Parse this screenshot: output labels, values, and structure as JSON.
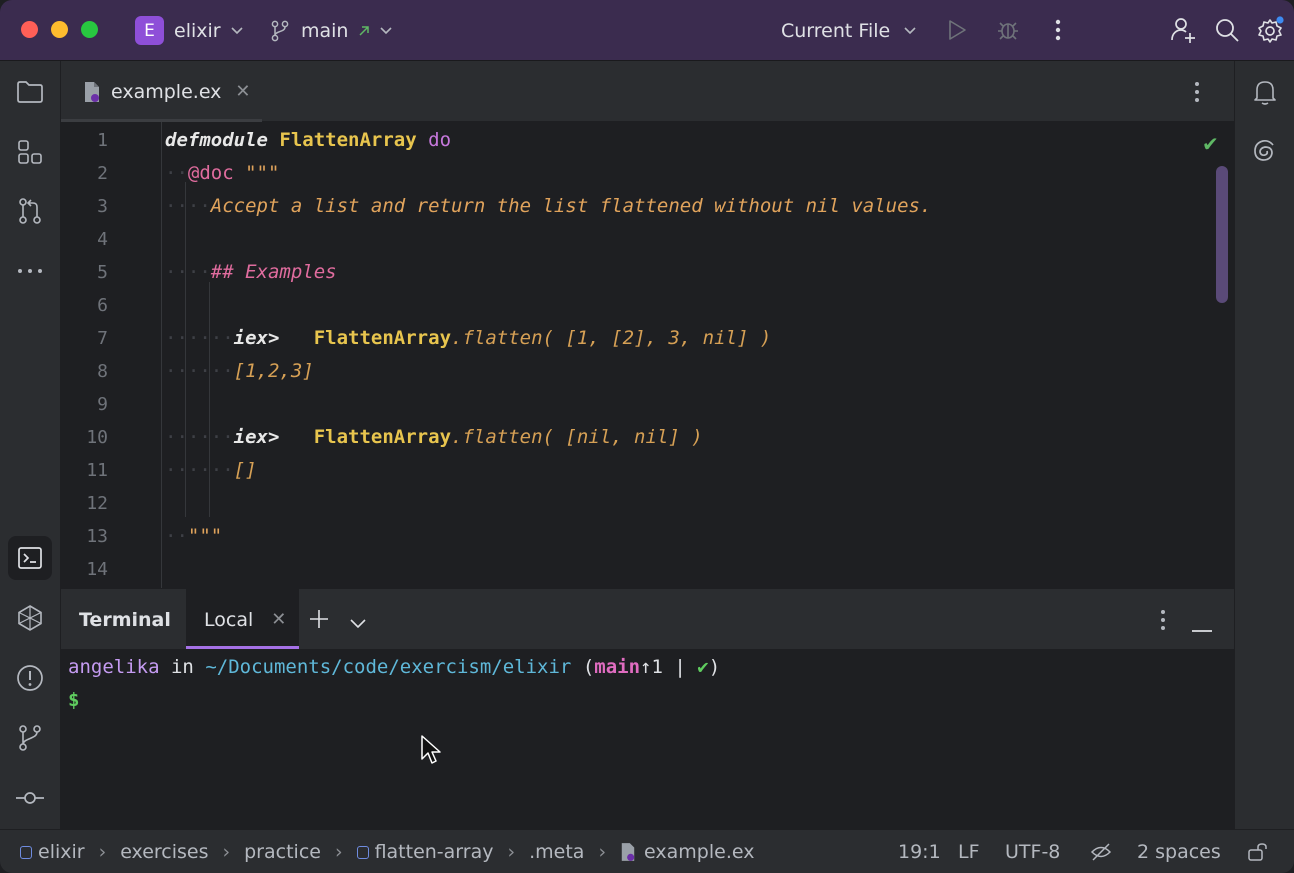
{
  "titlebar": {
    "project_badge": "E",
    "project_name": "elixir",
    "branch": "main",
    "run_config": "Current File"
  },
  "editor": {
    "tab_label": "example.ex",
    "lines": [
      {
        "n": "1"
      },
      {
        "n": "2"
      },
      {
        "n": "3"
      },
      {
        "n": "4"
      },
      {
        "n": "5"
      },
      {
        "n": "6"
      },
      {
        "n": "7"
      },
      {
        "n": "8"
      },
      {
        "n": "9"
      },
      {
        "n": "10"
      },
      {
        "n": "11"
      },
      {
        "n": "12"
      },
      {
        "n": "13"
      },
      {
        "n": "14"
      }
    ],
    "code": {
      "l1_kw": "defmodule",
      "l1_mod": "FlattenArray",
      "l1_do": "do",
      "l2_attr": "@doc",
      "l2_str": "\"\"\"",
      "l3_doc": "Accept a list and return the list flattened without nil values.",
      "l5_hdr": "## Examples",
      "l7_iex": "iex>",
      "l7_mod": "FlattenArray",
      "l7_call": ".flatten( [1, [2], 3, nil] )",
      "l8_out": "[1,2,3]",
      "l10_iex": "iex>",
      "l10_mod": "FlattenArray",
      "l10_call": ".flatten( [nil, nil] )",
      "l11_out": "[]",
      "l13_str": "\"\"\""
    }
  },
  "terminal": {
    "title": "Terminal",
    "tab_label": "Local",
    "user": "angelika",
    "in": "in",
    "path": "~/Documents/code/exercism/elixir",
    "open_paren": "(",
    "branch": "main",
    "ahead": "↑1 | ",
    "check": "✔",
    "close_paren": ")",
    "prompt": "$"
  },
  "statusbar": {
    "crumbs": [
      "elixir",
      "exercises",
      "practice",
      "flatten-array",
      ".meta",
      "example.ex"
    ],
    "position": "19:1",
    "line_sep": "LF",
    "encoding": "UTF-8",
    "indent": "2 spaces"
  },
  "colors": {
    "titlebar": "#3b2c4f",
    "accent": "#a571e6",
    "panel": "#2b2d30",
    "editor_bg": "#1e1f22"
  }
}
